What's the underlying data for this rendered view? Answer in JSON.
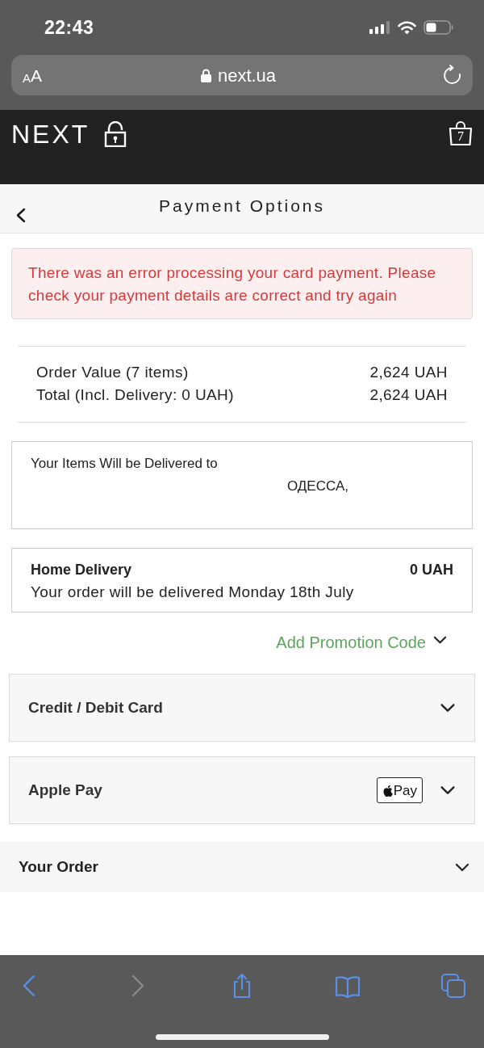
{
  "status_bar": {
    "time": "22:43"
  },
  "browser": {
    "text_size_button": "AA",
    "address": "next.ua"
  },
  "header": {
    "logo": "NEXT",
    "bag_count": "7"
  },
  "page": {
    "title": "Payment Options"
  },
  "error_message": "There was an error processing your card payment. Please check your payment details are correct and try again",
  "summary": [
    {
      "label": "Order Value (7 items)",
      "value": "2,624 UAH"
    },
    {
      "label": "Total (Incl. Delivery: 0 UAH)",
      "value": "2,624 UAH"
    }
  ],
  "delivery_address": {
    "heading": "Your Items Will be Delivered to",
    "lines": [
      "ОДЕССА,"
    ]
  },
  "delivery_method": {
    "name": "Home Delivery",
    "price": "0 UAH",
    "note": "Your order will be delivered Monday 18th July"
  },
  "promotion": {
    "label": "Add Promotion Code",
    "expanded": false
  },
  "payment_methods": [
    {
      "label": "Credit / Debit Card",
      "expanded": false
    },
    {
      "label": "Apple Pay",
      "badge": "Pay",
      "expanded": false
    }
  ],
  "your_order": {
    "label": "Your Order",
    "expanded": false
  },
  "browser_toolbar": [
    {
      "kind": "back",
      "disabled": false
    },
    {
      "kind": "forward",
      "disabled": true
    },
    {
      "kind": "share",
      "disabled": false
    },
    {
      "kind": "bookmarks",
      "disabled": false
    },
    {
      "kind": "tabs",
      "disabled": false
    }
  ]
}
